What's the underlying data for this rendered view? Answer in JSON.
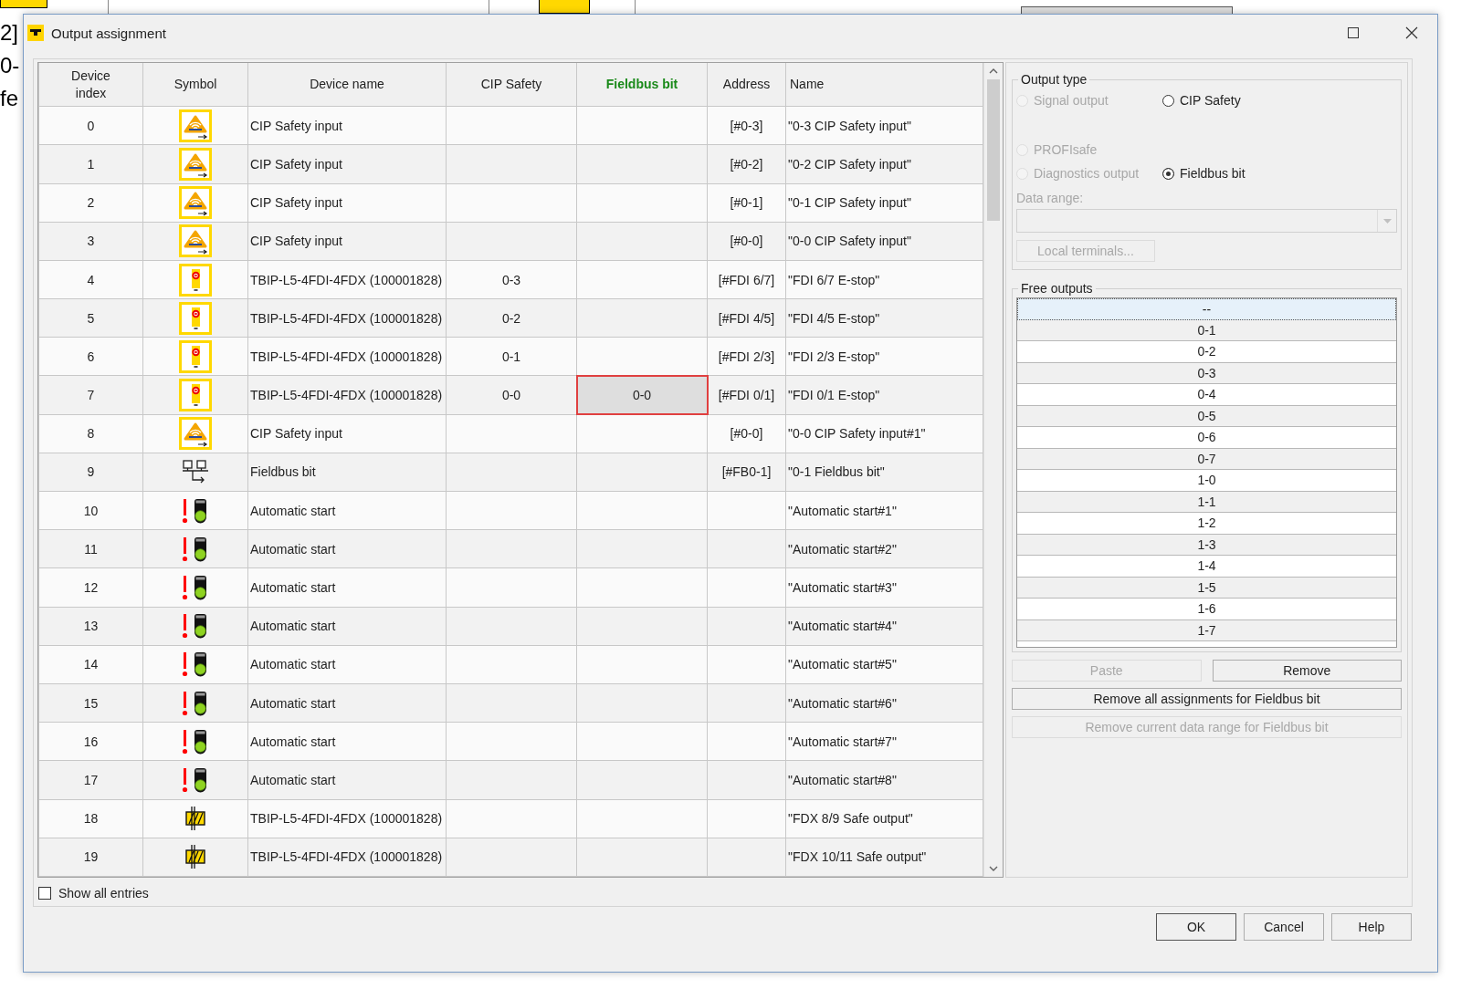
{
  "background": {
    "texts": [
      "2]",
      "0-",
      "fe"
    ]
  },
  "window": {
    "title": "Output assignment"
  },
  "table": {
    "columns": [
      {
        "label": "Device index",
        "active": false
      },
      {
        "label": "Symbol",
        "active": false
      },
      {
        "label": "Device name",
        "active": false
      },
      {
        "label": "CIP Safety",
        "active": false
      },
      {
        "label": "Fieldbus bit",
        "active": true
      },
      {
        "label": "Address",
        "active": false
      },
      {
        "label": "Name",
        "active": false
      }
    ],
    "rows": [
      {
        "index": "0",
        "kind": "cip",
        "device_name": "CIP Safety input",
        "address": "[#0-3]",
        "name": "\"0-3 CIP Safety input\"",
        "selected": false
      },
      {
        "index": "1",
        "kind": "cip",
        "device_name": "CIP Safety input",
        "address": "[#0-2]",
        "name": "\"0-2 CIP Safety input\"",
        "selected": false
      },
      {
        "index": "2",
        "kind": "cip",
        "device_name": "CIP Safety input",
        "address": "[#0-1]",
        "name": "\"0-1 CIP Safety input\"",
        "selected": false
      },
      {
        "index": "3",
        "kind": "cip",
        "device_name": "CIP Safety input",
        "address": "[#0-0]",
        "name": "\"0-0 CIP Safety input\"",
        "selected": false
      },
      {
        "index": "4",
        "kind": "estop",
        "device_name": "TBIP-L5-4FDI-4FDX (100001828)",
        "cip_safety": "0-3",
        "address": "[#FDI 6/7]",
        "name": "\"FDI 6/7 E-stop\"",
        "selected": false
      },
      {
        "index": "5",
        "kind": "estop",
        "device_name": "TBIP-L5-4FDI-4FDX (100001828)",
        "cip_safety": "0-2",
        "address": "[#FDI 4/5]",
        "name": "\"FDI 4/5 E-stop\"",
        "selected": false
      },
      {
        "index": "6",
        "kind": "estop",
        "device_name": "TBIP-L5-4FDI-4FDX (100001828)",
        "cip_safety": "0-1",
        "address": "[#FDI 2/3]",
        "name": "\"FDI 2/3 E-stop\"",
        "selected": false
      },
      {
        "index": "7",
        "kind": "estop",
        "device_name": "TBIP-L5-4FDI-4FDX (100001828)",
        "cip_safety": "0-0",
        "fieldbus_bit": "0-0",
        "address": "[#FDI 0/1]",
        "name": "\"FDI 0/1 E-stop\"",
        "selected": true
      },
      {
        "index": "8",
        "kind": "cip",
        "device_name": "CIP Safety input",
        "address": "[#0-0]",
        "name": "\"0-0 CIP Safety input#1\"",
        "selected": false
      },
      {
        "index": "9",
        "kind": "fieldbus",
        "device_name": "Fieldbus bit",
        "address": "[#FB0-1]",
        "name": "\"0-1 Fieldbus bit\"",
        "selected": false
      },
      {
        "index": "10",
        "kind": "autostart",
        "device_name": "Automatic start",
        "name": "\"Automatic start#1\"",
        "selected": false
      },
      {
        "index": "11",
        "kind": "autostart",
        "device_name": "Automatic start",
        "name": "\"Automatic start#2\"",
        "selected": false
      },
      {
        "index": "12",
        "kind": "autostart",
        "device_name": "Automatic start",
        "name": "\"Automatic start#3\"",
        "selected": false
      },
      {
        "index": "13",
        "kind": "autostart",
        "device_name": "Automatic start",
        "name": "\"Automatic start#4\"",
        "selected": false
      },
      {
        "index": "14",
        "kind": "autostart",
        "device_name": "Automatic start",
        "name": "\"Automatic start#5\"",
        "selected": false
      },
      {
        "index": "15",
        "kind": "autostart",
        "device_name": "Automatic start",
        "name": "\"Automatic start#6\"",
        "selected": false
      },
      {
        "index": "16",
        "kind": "autostart",
        "device_name": "Automatic start",
        "name": "\"Automatic start#7\"",
        "selected": false
      },
      {
        "index": "17",
        "kind": "autostart",
        "device_name": "Automatic start",
        "name": "\"Automatic start#8\"",
        "selected": false
      },
      {
        "index": "18",
        "kind": "output",
        "device_name": "TBIP-L5-4FDI-4FDX (100001828)",
        "name": "\"FDX 8/9 Safe output\"",
        "selected": false
      },
      {
        "index": "19",
        "kind": "output",
        "device_name": "TBIP-L5-4FDI-4FDX (100001828)",
        "name": "\"FDX 10/11 Safe output\"",
        "selected": false
      }
    ]
  },
  "show_all_entries": {
    "label": "Show all entries",
    "checked": false
  },
  "output_type": {
    "title": "Output type",
    "options": [
      {
        "label": "Signal output",
        "selected": false,
        "disabled": true
      },
      {
        "label": "CIP Safety",
        "selected": false,
        "disabled": false
      },
      {
        "label": "PROFIsafe",
        "selected": false,
        "disabled": true
      },
      {
        "label": "Diagnostics output",
        "selected": false,
        "disabled": true
      },
      {
        "label": "Fieldbus bit",
        "selected": true,
        "disabled": false
      }
    ],
    "data_range_label": "Data range:",
    "local_terminals": {
      "label": "Local terminals...",
      "disabled": true
    }
  },
  "free_outputs": {
    "title": "Free outputs",
    "items": [
      {
        "label": "--",
        "selected": true
      },
      {
        "label": "0-1",
        "selected": false
      },
      {
        "label": "0-2",
        "selected": false
      },
      {
        "label": "0-3",
        "selected": false
      },
      {
        "label": "0-4",
        "selected": false
      },
      {
        "label": "0-5",
        "selected": false
      },
      {
        "label": "0-6",
        "selected": false
      },
      {
        "label": "0-7",
        "selected": false
      },
      {
        "label": "1-0",
        "selected": false
      },
      {
        "label": "1-1",
        "selected": false
      },
      {
        "label": "1-2",
        "selected": false
      },
      {
        "label": "1-3",
        "selected": false
      },
      {
        "label": "1-4",
        "selected": false
      },
      {
        "label": "1-5",
        "selected": false
      },
      {
        "label": "1-6",
        "selected": false
      },
      {
        "label": "1-7",
        "selected": false
      }
    ]
  },
  "side_buttons": [
    {
      "label": "Paste",
      "disabled": true
    },
    {
      "label": "Remove",
      "disabled": false
    },
    {
      "label": "Remove all assignments for Fieldbus bit",
      "disabled": false
    },
    {
      "label": "Remove current data range for Fieldbus bit",
      "disabled": true
    }
  ],
  "dialog_buttons": [
    {
      "label": "OK",
      "default": true
    },
    {
      "label": "Cancel",
      "default": false
    },
    {
      "label": "Help",
      "default": false
    }
  ]
}
